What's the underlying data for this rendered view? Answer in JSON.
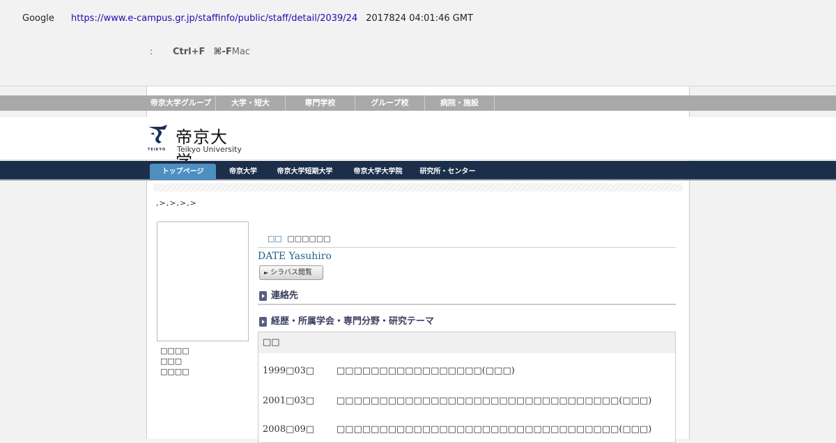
{
  "cache_banner": {
    "google": "Google",
    "url": "https://www.e-campus.gr.jp/staffinfo/public/staff/detail/2039/24",
    "timestamp": "2017824 04:01:46 GMT",
    "colon": ":",
    "shortcut_win": "Ctrl+F",
    "shortcut_mac": "⌘-F",
    "mac_label": "Mac"
  },
  "group_nav": [
    "帝京大学グループ",
    "大学・短大",
    "専門学校",
    "グループ校",
    "病院・施設"
  ],
  "logo": {
    "jp": "帝京大学",
    "en": "Teikyo University",
    "mark_text": "TEIKYO"
  },
  "main_nav": [
    {
      "label": "トップページ",
      "active": true
    },
    {
      "label": "帝京大学",
      "active": false
    },
    {
      "label": "帝京大学短期大学",
      "active": false
    },
    {
      "label": "帝京大学大学院",
      "active": false
    },
    {
      "label": "研究所・センター",
      "active": false
    }
  ],
  "breadcrumb": ",>,>,>,>",
  "profile": {
    "info_lines": [
      "\u0000\u0000\u0000\u0000",
      "\u0000\u0000\u0000",
      "\u0000\u0000\u0000\u0000"
    ],
    "position": "\u0000\u0000",
    "name_jp": "\u0000\u0000\u0000\u0000\u0000\u0000",
    "name_en": "DATE Yasuhiro",
    "syllabus_button": "シラバス閲覧"
  },
  "sections": {
    "contact": "連絡先",
    "career": "経歴・所属学会・専門分野・研究テーマ"
  },
  "history": {
    "header": "\u0000\u0000",
    "rows": [
      {
        "date": "1999\u000003\u0000",
        "text": "\u0000\u0000\u0000\u0000\u0000\u0000\u0000\u0000\u0000\u0000\u0000\u0000\u0000\u0000\u0000\u0000\u0000(\u0000\u0000\u0000)"
      },
      {
        "date": "2001\u000003\u0000",
        "text": "\u0000\u0000\u0000\u0000\u0000\u0000\u0000\u0000\u0000\u0000\u0000\u0000\u0000\u0000\u0000\u0000\u0000\u0000\u0000\u0000\u0000\u0000\u0000\u0000\u0000\u0000\u0000\u0000\u0000\u0000\u0000\u0000\u0000(\u0000\u0000\u0000)"
      },
      {
        "date": "2008\u000009\u0000",
        "text": "\u0000\u0000\u0000\u0000\u0000\u0000\u0000\u0000\u0000\u0000\u0000\u0000\u0000\u0000\u0000\u0000\u0000\u0000\u0000\u0000\u0000\u0000\u0000\u0000\u0000\u0000\u0000\u0000\u0000\u0000\u0000\u0000\u0000(\u0000\u0000\u0000)"
      }
    ]
  }
}
